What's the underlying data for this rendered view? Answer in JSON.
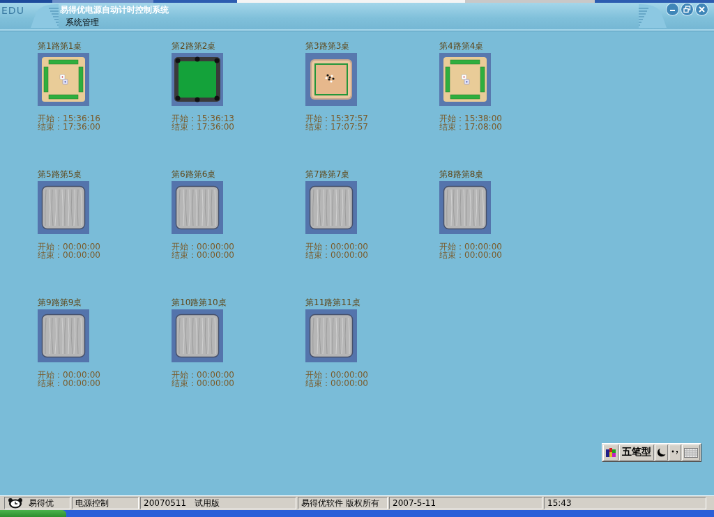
{
  "window": {
    "logo": "EDU",
    "title": "易得优电源自动计时控制系统",
    "menu": [
      {
        "label": "系统管理"
      }
    ]
  },
  "tables": [
    {
      "name": "第1路第1桌",
      "kind": "mahjong",
      "start": "开始：15:36:16",
      "end": "结束：17:36:00"
    },
    {
      "name": "第2路第2桌",
      "kind": "billiards",
      "start": "开始：15:36:13",
      "end": "结束：17:36:00"
    },
    {
      "name": "第3路第3桌",
      "kind": "go",
      "start": "开始：15:37:57",
      "end": "结束：17:07:57"
    },
    {
      "name": "第4路第4桌",
      "kind": "mahjong",
      "start": "开始：15:38:00",
      "end": "结束：17:08:00"
    },
    {
      "name": "第5路第5桌",
      "kind": "empty",
      "start": "开始：00:00:00",
      "end": "结束：00:00:00"
    },
    {
      "name": "第6路第6桌",
      "kind": "empty",
      "start": "开始：00:00:00",
      "end": "结束：00:00:00"
    },
    {
      "name": "第7路第7桌",
      "kind": "empty",
      "start": "开始：00:00:00",
      "end": "结束：00:00:00"
    },
    {
      "name": "第8路第8桌",
      "kind": "empty",
      "start": "开始：00:00:00",
      "end": "结束：00:00:00"
    },
    {
      "name": "第9路第9桌",
      "kind": "empty",
      "start": "开始：00:00:00",
      "end": "结束：00:00:00"
    },
    {
      "name": "第10路第10桌",
      "kind": "empty",
      "start": "开始：00:00:00",
      "end": "结束：00:00:00"
    },
    {
      "name": "第11路第11桌",
      "kind": "empty",
      "start": "开始：00:00:00",
      "end": "结束：00:00:00"
    }
  ],
  "ime_toolbar": {
    "mode": "五笔型"
  },
  "status_bar": {
    "app": "易得优",
    "module": "电源控制",
    "version": "20070511",
    "edition": "试用版",
    "copyright": "易得优软件 版权所有",
    "date": "2007-5-11",
    "time": "15:43"
  }
}
